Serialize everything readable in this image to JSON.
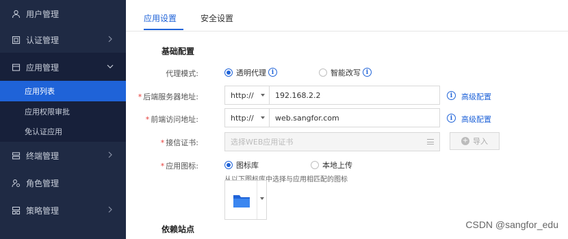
{
  "sidebar": {
    "groups": [
      {
        "label": "用户管理",
        "icon": "user-icon"
      },
      {
        "label": "认证管理",
        "icon": "auth-icon"
      },
      {
        "label": "应用管理",
        "icon": "app-icon"
      },
      {
        "label": "终端管理",
        "icon": "terminal-icon"
      },
      {
        "label": "角色管理",
        "icon": "role-icon"
      },
      {
        "label": "策略管理",
        "icon": "policy-icon"
      }
    ],
    "sub_items": [
      {
        "label": "应用列表"
      },
      {
        "label": "应用权限审批"
      },
      {
        "label": "免认证应用"
      }
    ]
  },
  "tabs": [
    {
      "label": "应用设置"
    },
    {
      "label": "安全设置"
    }
  ],
  "form": {
    "section_title": "基础配置",
    "proxy_mode": {
      "label": "代理模式:",
      "options": [
        "透明代理",
        "智能改写"
      ]
    },
    "backend": {
      "label": "后端服务器地址:",
      "protocol": "http://",
      "value": "192.168.2.2",
      "advanced": "高级配置"
    },
    "frontend": {
      "label": "前端访问地址:",
      "protocol": "http://",
      "value": "web.sangfor.com",
      "advanced": "高级配置"
    },
    "cert": {
      "label": "接信证书:",
      "placeholder": "选择WEB应用证书",
      "import_label": "导入"
    },
    "app_icon": {
      "label": "应用图标:",
      "options": [
        "图标库",
        "本地上传"
      ],
      "hint": "从以下图标库中选择与应用相匹配的图标"
    },
    "next_section_title": "依赖站点"
  },
  "watermark": "CSDN @sangfor_edu",
  "colors": {
    "sidebar_bg": "#1f2a44",
    "accent": "#1f63d8",
    "required": "#e53935"
  }
}
